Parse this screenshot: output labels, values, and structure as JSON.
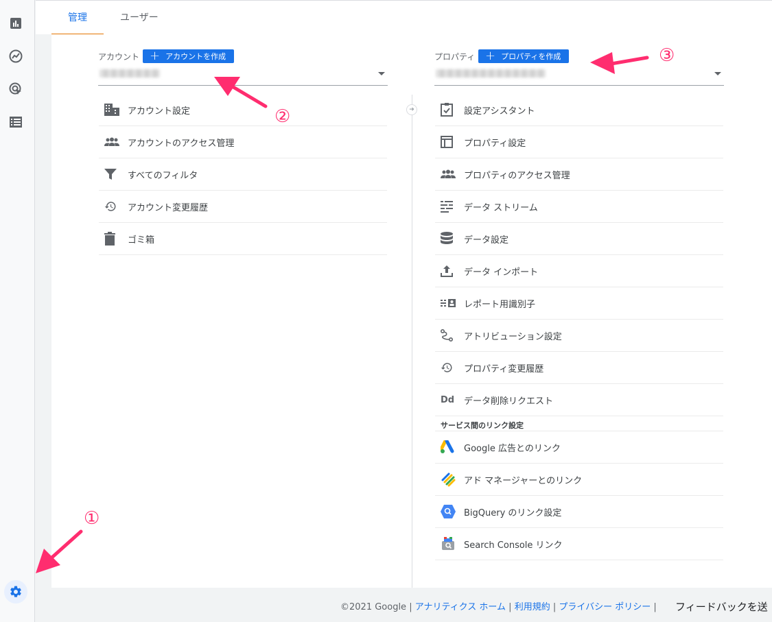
{
  "tabs": [
    {
      "label": "管理",
      "active": true
    },
    {
      "label": "ユーザー",
      "active": false
    }
  ],
  "rail": {
    "items": [
      "bar-chart-icon",
      "trend-icon",
      "target-click-icon",
      "list-icon"
    ],
    "gear": "gear-icon"
  },
  "account": {
    "label": "アカウント",
    "create_button": "アカウントを作成",
    "menu": [
      {
        "label": "アカウント設定",
        "icon": "building-icon"
      },
      {
        "label": "アカウントのアクセス管理",
        "icon": "people-icon"
      },
      {
        "label": "すべてのフィルタ",
        "icon": "filter-icon"
      },
      {
        "label": "アカウント変更履歴",
        "icon": "history-icon"
      },
      {
        "label": "ゴミ箱",
        "icon": "trash-icon"
      }
    ]
  },
  "property": {
    "label": "プロパティ",
    "create_button": "プロパティを作成",
    "menu": [
      {
        "label": "設定アシスタント",
        "icon": "checklist-icon"
      },
      {
        "label": "プロパティ設定",
        "icon": "layout-icon"
      },
      {
        "label": "プロパティのアクセス管理",
        "icon": "people-icon"
      },
      {
        "label": "データ ストリーム",
        "icon": "stream-icon"
      },
      {
        "label": "データ設定",
        "icon": "database-icon"
      },
      {
        "label": "データ インポート",
        "icon": "upload-icon"
      },
      {
        "label": "レポート用識別子",
        "icon": "identifier-icon"
      },
      {
        "label": "アトリビューション設定",
        "icon": "attribution-icon"
      },
      {
        "label": "プロパティ変更履歴",
        "icon": "history-icon"
      },
      {
        "label": "データ削除リクエスト",
        "icon": "dd-icon"
      }
    ],
    "links_section": "サービス間のリンク設定",
    "links": [
      {
        "label": "Google 広告とのリンク",
        "icon": "google-ads-icon"
      },
      {
        "label": "アド マネージャーとのリンク",
        "icon": "ad-manager-icon"
      },
      {
        "label": "BigQuery のリンク設定",
        "icon": "bigquery-icon"
      },
      {
        "label": "Search Console リンク",
        "icon": "search-console-icon"
      }
    ]
  },
  "footer": {
    "copyright": "©2021 Google",
    "links": [
      "アナリティクス ホーム",
      "利用規約",
      "プライバシー ポリシー"
    ],
    "feedback": "フィードバックを送"
  },
  "annotations": {
    "one": "①",
    "two": "②",
    "three": "③",
    "color": "#ff2d6f"
  },
  "dk": "Dd"
}
